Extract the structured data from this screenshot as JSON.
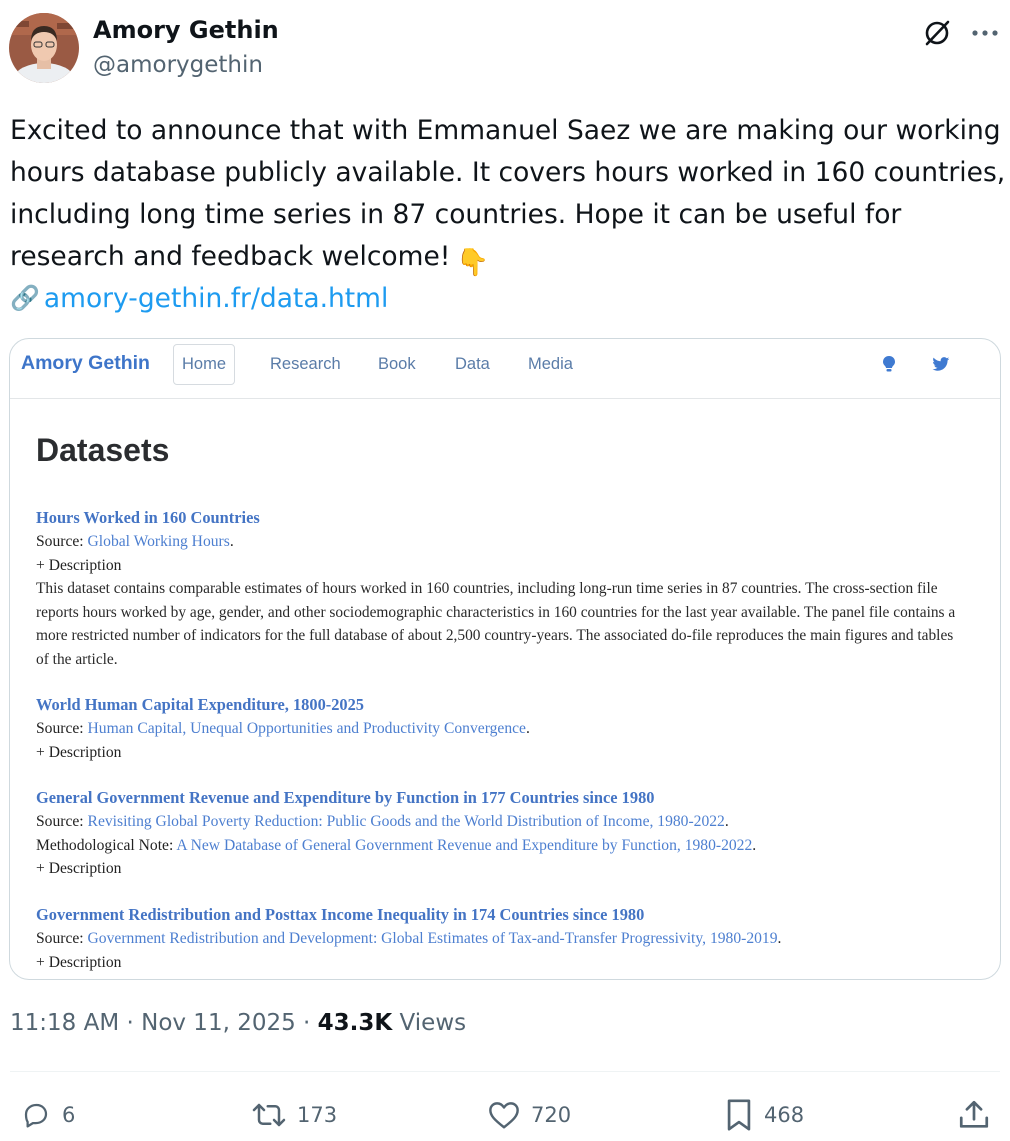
{
  "author": {
    "name": "Amory Gethin",
    "handle": "@amorygethin"
  },
  "post": {
    "lines": [
      "Excited to announce that with Emmanuel Saez we are making our working",
      "hours database publicly available. It covers hours worked in 160 countries,",
      "including long time series in 87 countries. Hope it can be useful for",
      "research and feedback welcome!"
    ],
    "emoji": "👇",
    "link_icon": "🔗",
    "link": "amory-gethin.fr/data.html"
  },
  "card": {
    "brand": "Amory Gethin",
    "nav": [
      "Home",
      "Research",
      "Book",
      "Data",
      "Media"
    ],
    "nav_icons": [
      "bulb-icon",
      "twitter-icon"
    ],
    "heading": "Datasets",
    "datasets": [
      {
        "title": "Hours Worked in 160 Countries",
        "source_label": "Source: ",
        "source_link": "Global Working Hours",
        "source_end": ".",
        "toggle": "+ Description",
        "description": "This dataset contains comparable estimates of hours worked in 160 countries, including long-run time series in 87 countries. The cross-section file reports hours worked by age, gender, and other sociodemographic characteristics in 160 countries for the last year available. The panel file contains a more restricted number of indicators for the full database of about 2,500 country-years. The associated do-file reproduces the main figures and tables of the article."
      },
      {
        "title": "World Human Capital Expenditure, 1800-2025",
        "source_label": "Source: ",
        "source_link": "Human Capital, Unequal Opportunities and Productivity Convergence",
        "source_end": ".",
        "toggle": "+ Description"
      },
      {
        "title": "General Government Revenue and Expenditure by Function in 177 Countries since 1980",
        "source_label": "Source: ",
        "source_link": "Revisiting Global Poverty Reduction: Public Goods and the World Distribution of Income, 1980-2022",
        "source_end": ".",
        "note_label": "Methodological Note: ",
        "note_link": "A New Database of General Government Revenue and Expenditure by Function, 1980-2022",
        "note_end": ".",
        "toggle": "+ Description"
      },
      {
        "title": "Government Redistribution and Posttax Income Inequality in 174 Countries since 1980",
        "source_label": "Source: ",
        "source_link": "Government Redistribution and Development: Global Estimates of Tax-and-Transfer Progressivity, 1980-2019",
        "source_end": ".",
        "toggle": "+ Description"
      }
    ]
  },
  "meta": {
    "time": "11:18 AM",
    "sep1": " · ",
    "date": "Nov 11, 2025",
    "sep2": " · ",
    "views_count": "43.3K",
    "views_label": " Views"
  },
  "actions": {
    "replies": "6",
    "reposts": "173",
    "likes": "720",
    "bookmarks": "468"
  },
  "colors": {
    "link": "#1d9bf0",
    "text": "#0f1419",
    "muted": "#536471",
    "site_blue": "#4474c4"
  }
}
